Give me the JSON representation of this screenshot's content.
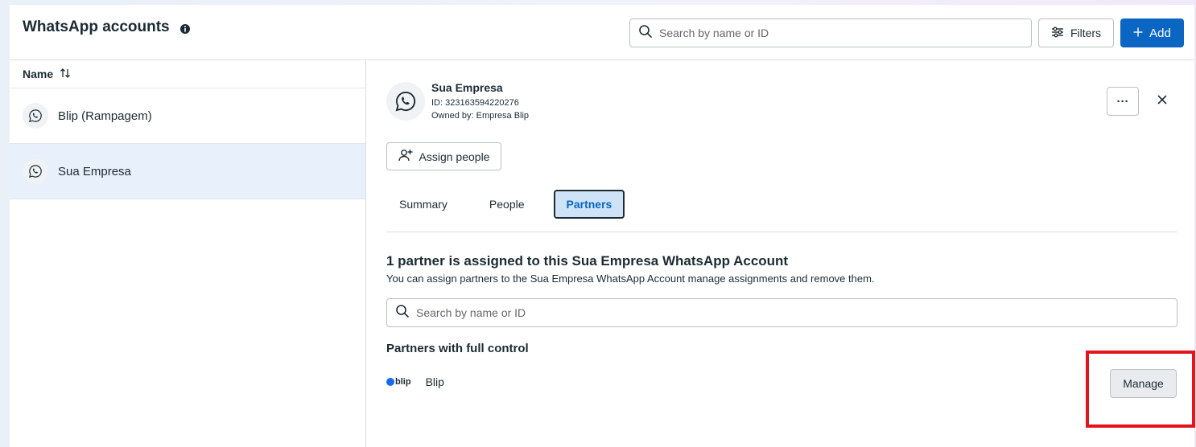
{
  "header": {
    "title": "WhatsApp accounts",
    "search_placeholder": "Search by name or ID",
    "filters_label": "Filters",
    "add_label": "Add"
  },
  "list": {
    "column_header": "Name",
    "items": [
      {
        "label": "Blip (Rampagem)",
        "selected": false
      },
      {
        "label": "Sua Empresa",
        "selected": true
      }
    ]
  },
  "detail": {
    "name": "Sua Empresa",
    "id_text": "ID: 323163594220276",
    "owner_text": "Owned by: Empresa Blip",
    "more_label": "···",
    "assign_label": "Assign people",
    "tabs": [
      {
        "label": "Summary",
        "active": false
      },
      {
        "label": "People",
        "active": false
      },
      {
        "label": "Partners",
        "active": true
      }
    ],
    "partners_title": "1 partner is assigned to this Sua Empresa WhatsApp Account",
    "partners_desc": "You can assign partners to the Sua Empresa WhatsApp Account manage assignments and remove them.",
    "search_placeholder": "Search by name or ID",
    "full_control_title": "Partners with full control",
    "partners": [
      {
        "logo_text": "blip",
        "name": "Blip",
        "action_label": "Manage"
      }
    ]
  },
  "colors": {
    "primary": "#0a66c2",
    "selected_row": "#e7f0fb",
    "active_tab_bg": "#cfe3f8",
    "highlight": "#e3141b",
    "blip_brand": "#1968f0"
  }
}
